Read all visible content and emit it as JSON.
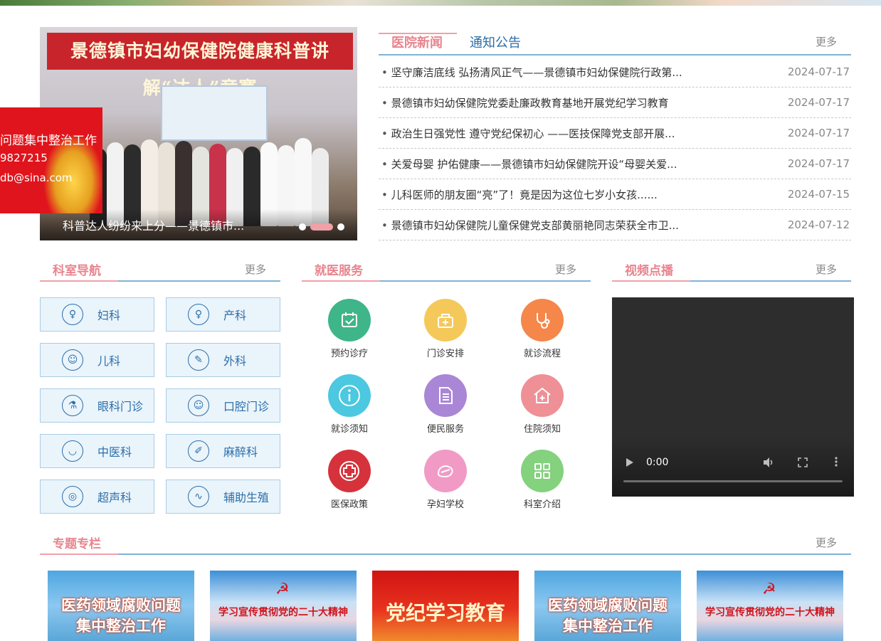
{
  "carousel": {
    "banner_text": "景德镇市妇幼保健院健康科普讲解“达人”竞赛",
    "caption": "科普达人纷纷来上分——景德镇市..."
  },
  "float_ad": {
    "lines": [
      "问题集中整治工作",
      "9827215",
      "db@sina.com"
    ]
  },
  "news": {
    "tabs": [
      "医院新闻",
      "通知公告"
    ],
    "more_label": "更多",
    "items": [
      {
        "title": "坚守廉洁底线 弘扬清风正气——景德镇市妇幼保健院行政第...",
        "date": "2024-07-17"
      },
      {
        "title": "景德镇市妇幼保健院党委赴廉政教育基地开展党纪学习教育",
        "date": "2024-07-17"
      },
      {
        "title": "政治生日强党性 遵守党纪保初心 ——医技保障党支部开展...",
        "date": "2024-07-17"
      },
      {
        "title": "关爱母婴 护佑健康——景德镇市妇幼保健院开设“母婴关爱...",
        "date": "2024-07-17"
      },
      {
        "title": "儿科医师的朋友圈“亮”了！竟是因为这位七岁小女孩......",
        "date": "2024-07-15"
      },
      {
        "title": "景德镇市妇幼保健院儿童保健党支部黄丽艳同志荣获全市卫...",
        "date": "2024-07-12"
      }
    ]
  },
  "departments": {
    "title": "科室导航",
    "more_label": "更多",
    "items": [
      "妇科",
      "产科",
      "儿科",
      "外科",
      "眼科门诊",
      "口腔门诊",
      "中医科",
      "麻醉科",
      "超声科",
      "辅助生殖"
    ]
  },
  "services": {
    "title": "就医服务",
    "more_label": "更多",
    "items": [
      {
        "label": "预约诊疗",
        "icon": "calendar-check-icon",
        "color": "#3fb58a"
      },
      {
        "label": "门诊安排",
        "icon": "medical-kit-icon",
        "color": "#f5c85a"
      },
      {
        "label": "就诊流程",
        "icon": "stethoscope-icon",
        "color": "#f5874a"
      },
      {
        "label": "就诊须知",
        "icon": "info-icon",
        "color": "#4cc8e0"
      },
      {
        "label": "便民服务",
        "icon": "document-icon",
        "color": "#a986d6"
      },
      {
        "label": "住院须知",
        "icon": "house-plus-icon",
        "color": "#ef8f96"
      },
      {
        "label": "医保政策",
        "icon": "insurance-icon",
        "color": "#d6323c"
      },
      {
        "label": "孕妇学校",
        "icon": "baby-bottle-icon",
        "color": "#f29ac6"
      },
      {
        "label": "科室介绍",
        "icon": "grid-icon",
        "color": "#84d17e"
      }
    ]
  },
  "video": {
    "title": "视频点播",
    "more_label": "更多",
    "time": "0:00"
  },
  "special": {
    "title": "专题专栏",
    "more_label": "更多",
    "items": [
      {
        "line1": "医药领域腐败问题",
        "line2": "集中整治工作"
      },
      {
        "line1": "学习宣传贯彻党的二十大精神",
        "line2": ""
      },
      {
        "line1": "党纪学习教育",
        "line2": ""
      },
      {
        "line1": "医药领域腐败问题",
        "line2": "集中整治工作"
      },
      {
        "line1": "学习宣传贯彻党的二十大精神",
        "line2": ""
      }
    ]
  }
}
